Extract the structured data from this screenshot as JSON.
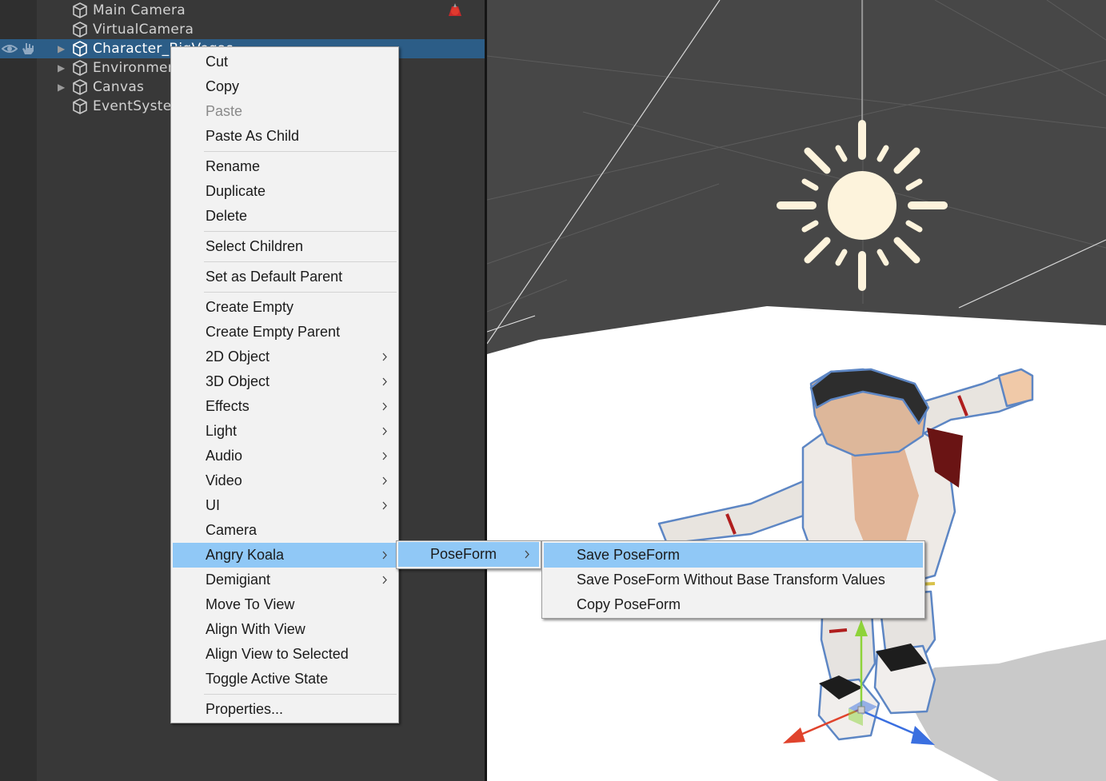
{
  "hierarchy": {
    "items": [
      {
        "label": "Main Camera",
        "has_children": false,
        "selected": false
      },
      {
        "label": "VirtualCamera",
        "has_children": false,
        "selected": false
      },
      {
        "label": "Character_BigVegas",
        "has_children": true,
        "selected": true
      },
      {
        "label": "Environment",
        "has_children": true,
        "selected": false
      },
      {
        "label": "Canvas",
        "has_children": true,
        "selected": false
      },
      {
        "label": "EventSystem",
        "has_children": false,
        "selected": false
      }
    ],
    "icons": {
      "row": "gameobject-cube-icon",
      "visibility": "eye-icon",
      "pickability": "hand-icon",
      "scene": "unsaved-scene-icon"
    }
  },
  "context_menu": {
    "items": [
      {
        "label": "Cut"
      },
      {
        "label": "Copy"
      },
      {
        "label": "Paste",
        "disabled": true
      },
      {
        "label": "Paste As Child"
      },
      {
        "separator": true
      },
      {
        "label": "Rename"
      },
      {
        "label": "Duplicate"
      },
      {
        "label": "Delete"
      },
      {
        "separator": true
      },
      {
        "label": "Select Children"
      },
      {
        "separator": true
      },
      {
        "label": "Set as Default Parent"
      },
      {
        "separator": true
      },
      {
        "label": "Create Empty"
      },
      {
        "label": "Create Empty Parent"
      },
      {
        "label": "2D Object",
        "submenu": true
      },
      {
        "label": "3D Object",
        "submenu": true
      },
      {
        "label": "Effects",
        "submenu": true
      },
      {
        "label": "Light",
        "submenu": true
      },
      {
        "label": "Audio",
        "submenu": true
      },
      {
        "label": "Video",
        "submenu": true
      },
      {
        "label": "UI",
        "submenu": true
      },
      {
        "label": "Camera"
      },
      {
        "label": "Angry Koala",
        "submenu": true,
        "highlighted": true
      },
      {
        "label": "Demigiant",
        "submenu": true
      },
      {
        "label": "Move To View"
      },
      {
        "label": "Align With View"
      },
      {
        "label": "Align View to Selected"
      },
      {
        "label": "Toggle Active State"
      },
      {
        "separator": true
      },
      {
        "label": "Properties..."
      }
    ]
  },
  "angry_koala_submenu": {
    "items": [
      {
        "label": "PoseForm",
        "submenu": true,
        "highlighted": true
      }
    ]
  },
  "poseform_submenu": {
    "items": [
      {
        "label": "Save PoseForm",
        "highlighted": true
      },
      {
        "label": "Save PoseForm Without Base Transform Values"
      },
      {
        "label": "Copy PoseForm"
      }
    ]
  },
  "scene": {
    "icons": {
      "light": "directional-light-sun-icon",
      "gizmo": "move-tool-gizmo-icon",
      "character": "character-model"
    },
    "colors": {
      "background": "#474747",
      "ground": "#ffffff",
      "grid": "#5c5c5c",
      "sun": "#fdf3dc",
      "axis_x": "#e0432c",
      "axis_y": "#8ed33a",
      "axis_z": "#3a6fe0"
    }
  },
  "colors": {
    "selection": "#2c5d87",
    "menu_highlight": "#90c8f6",
    "menu_bg": "#f2f2f2"
  }
}
